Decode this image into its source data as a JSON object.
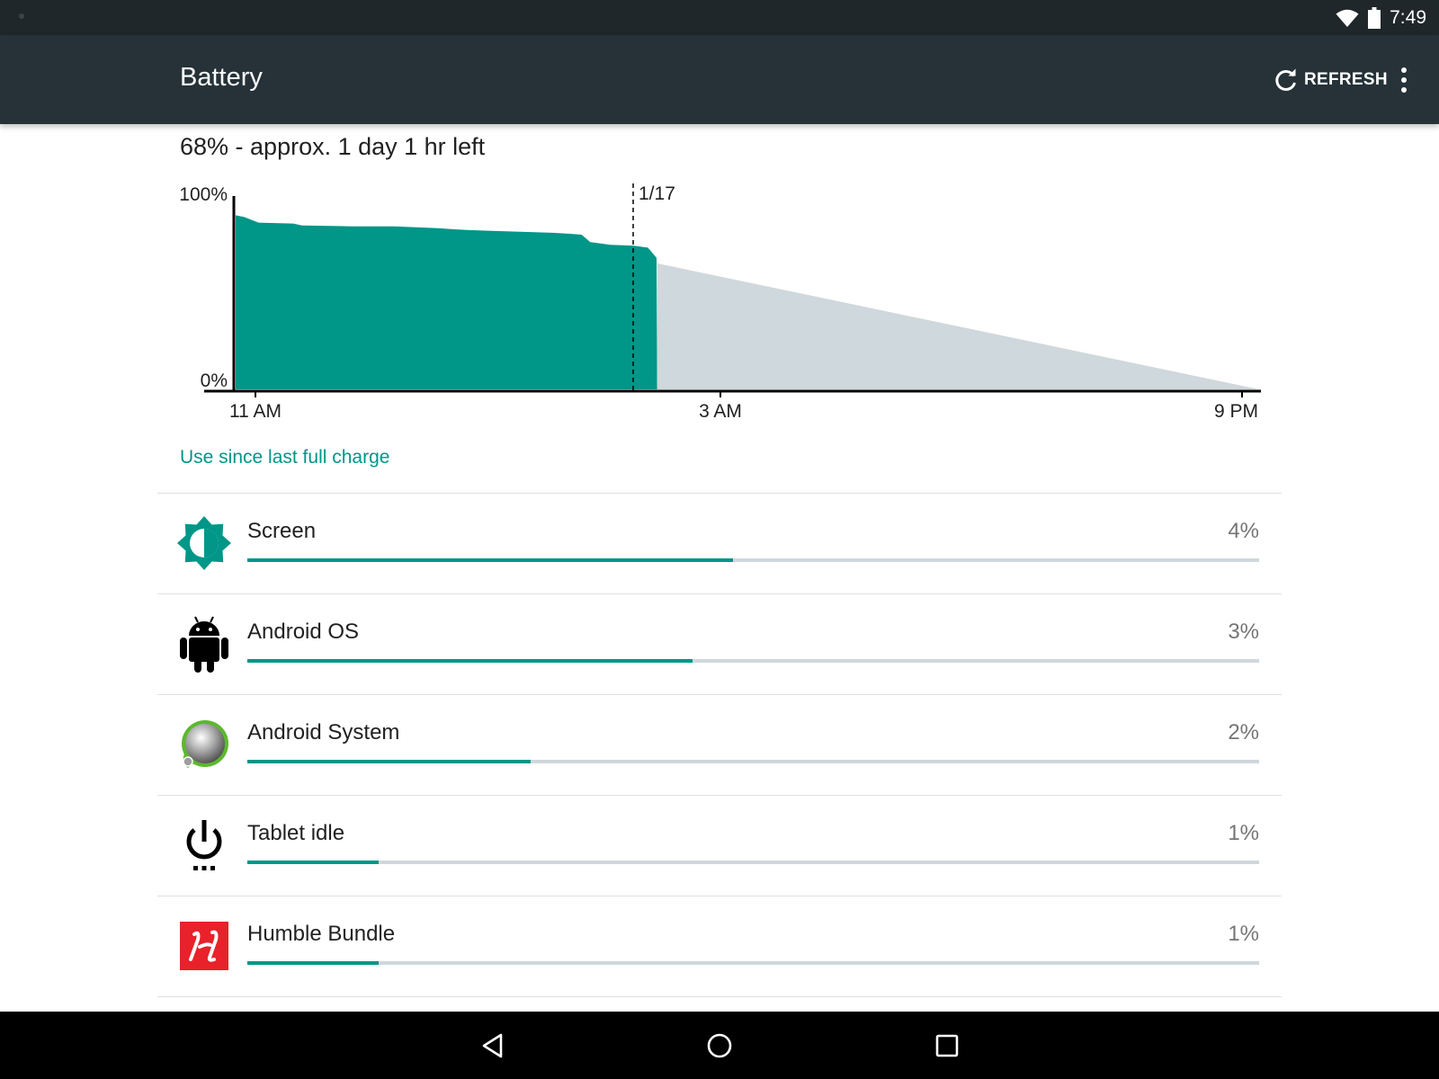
{
  "status_bar": {
    "time": "7:49",
    "icons": [
      "wifi-icon",
      "battery-icon"
    ]
  },
  "app_bar": {
    "title": "Battery",
    "refresh_label": "REFRESH",
    "icons": [
      "refresh-icon",
      "more-vert-icon"
    ],
    "background": "#263238"
  },
  "summary": "68% - approx. 1 day 1 hr left",
  "chart_data": {
    "type": "area",
    "y_tick_labels": [
      "100%",
      "0%"
    ],
    "x_tick_labels": [
      "11 AM",
      "3 AM",
      "9 PM"
    ],
    "day_marker": "1/17",
    "ylim": [
      0,
      100
    ],
    "x_unit": "hours from 11 AM",
    "xlim": [
      0,
      35.5
    ],
    "series": [
      {
        "values": [
          [
            0,
            94
          ],
          [
            0.3,
            93
          ],
          [
            0.8,
            90
          ],
          [
            2.0,
            89.5
          ],
          [
            2.3,
            88.5
          ],
          [
            4.0,
            88
          ],
          [
            5.5,
            88
          ],
          [
            7.0,
            87
          ],
          [
            8.0,
            86
          ],
          [
            9.0,
            85.5
          ],
          [
            10.0,
            85
          ],
          [
            11.0,
            84.5
          ],
          [
            11.6,
            84
          ],
          [
            12.0,
            83.5
          ],
          [
            12.3,
            79.5
          ],
          [
            13.0,
            78
          ],
          [
            13.8,
            77.5
          ],
          [
            14.3,
            76.5
          ],
          [
            14.6,
            71
          ],
          [
            14.62,
            0
          ]
        ],
        "color": "#009688"
      },
      {
        "values": [
          [
            14.62,
            68
          ],
          [
            35.5,
            0
          ]
        ],
        "color": "#cfd8dc"
      }
    ],
    "grid": false
  },
  "section_title": "Use since last full charge",
  "usage": [
    {
      "label": "Screen",
      "percent": "4%",
      "share": 0.48,
      "icon": "brightness-icon"
    },
    {
      "label": "Android OS",
      "percent": "3%",
      "share": 0.44,
      "icon": "android-icon"
    },
    {
      "label": "Android System",
      "percent": "2%",
      "share": 0.28,
      "icon": "android-system-icon"
    },
    {
      "label": "Tablet idle",
      "percent": "1%",
      "share": 0.13,
      "icon": "power-idle-icon"
    },
    {
      "label": "Humble Bundle",
      "percent": "1%",
      "share": 0.13,
      "icon": "humble-bundle-icon"
    }
  ],
  "nav_bar": {
    "icons": [
      "back-icon",
      "home-icon",
      "recents-icon"
    ]
  },
  "colors": {
    "accent": "#009688",
    "projection": "#cfd8dc",
    "app_bar": "#263238",
    "status_bar": "#1f272b"
  }
}
